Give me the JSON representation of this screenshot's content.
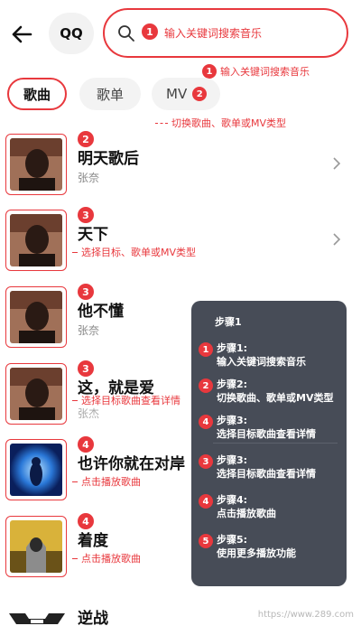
{
  "header": {
    "back_icon": "arrow-left-icon",
    "qq_label": "QQ",
    "search_placeholder": "输入关键词搜索音乐",
    "search_badge": "1",
    "callout_badge": "1",
    "callout_text": "输入关键词搜索音乐"
  },
  "tabs": {
    "items": [
      {
        "label": "歌曲"
      },
      {
        "label": "歌单"
      },
      {
        "label": "MV"
      }
    ],
    "mv_badge": "2",
    "callout_text": "切换歌曲、歌单或MV类型"
  },
  "songs": [
    {
      "badge": "2",
      "title": "明天歌后",
      "artist": "张奈",
      "callout": ""
    },
    {
      "badge": "3",
      "title": "天下",
      "artist": "",
      "callout": "选择目标、歌单或MV类型"
    },
    {
      "badge": "3",
      "title": "他不懂",
      "artist": "张奈",
      "callout": ""
    },
    {
      "badge": "3",
      "title": "这，就是爱",
      "artist": "张杰",
      "callout": "选择目标歌曲查看详情"
    },
    {
      "badge": "4",
      "title": "也许你就在对岸",
      "artist": "",
      "callout": "点击播放歌曲"
    },
    {
      "badge": "4",
      "title": "着度",
      "artist": "",
      "callout": "点击播放歌曲"
    },
    {
      "badge": "",
      "title": "逆战",
      "artist": "",
      "callout": ""
    }
  ],
  "steps_panel": {
    "title": "步骤1",
    "steps": [
      {
        "badge": "1",
        "label": "步骤1:",
        "desc": "输入关键词搜索音乐"
      },
      {
        "badge": "2",
        "label": "步骤2:",
        "desc": "切换歌曲、歌单或MV类型"
      },
      {
        "badge": "4",
        "label": "步骤3:",
        "desc": "选择目标歌曲查看详情"
      },
      {
        "badge": "3",
        "label": "步骤3:",
        "desc": "选择目标歌曲查看详情"
      },
      {
        "badge": "4",
        "label": "步骤4:",
        "desc": "点击播放歌曲"
      },
      {
        "badge": "5",
        "label": "步骤5:",
        "desc": "使用更多播放功能"
      }
    ]
  },
  "watermark": "https://www.289.com",
  "colors": {
    "accent": "#e8383d",
    "panel_bg": "#474c57"
  }
}
